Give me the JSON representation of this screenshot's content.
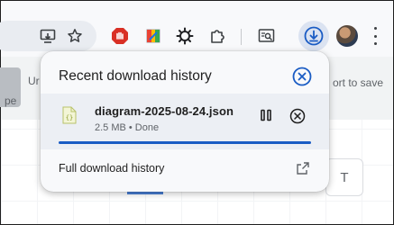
{
  "toolbar": {
    "icons": [
      "screen-cast-icon",
      "bookmark-star-icon",
      "stop-sign-extension-icon",
      "color-picker-extension-icon",
      "sun-extension-icon",
      "puzzle-extensions-icon",
      "reading-search-icon",
      "download-icon",
      "avatar",
      "more-menu-icon"
    ]
  },
  "page": {
    "banner_left_text_1": "Ur",
    "banner_left_text_2": "pe",
    "banner_right_text": "ort to save",
    "float_box_glyph": "T"
  },
  "popup": {
    "title": "Recent download history",
    "items": [
      {
        "file_name": "diagram-2025-08-24.json",
        "meta": "2.5 MB • Done",
        "progress": 1.0
      }
    ],
    "full_history_label": "Full download history"
  },
  "colors": {
    "accent": "#1a5cc4",
    "popup_bg": "#f8f9fb",
    "item_bg": "#eceff4"
  }
}
